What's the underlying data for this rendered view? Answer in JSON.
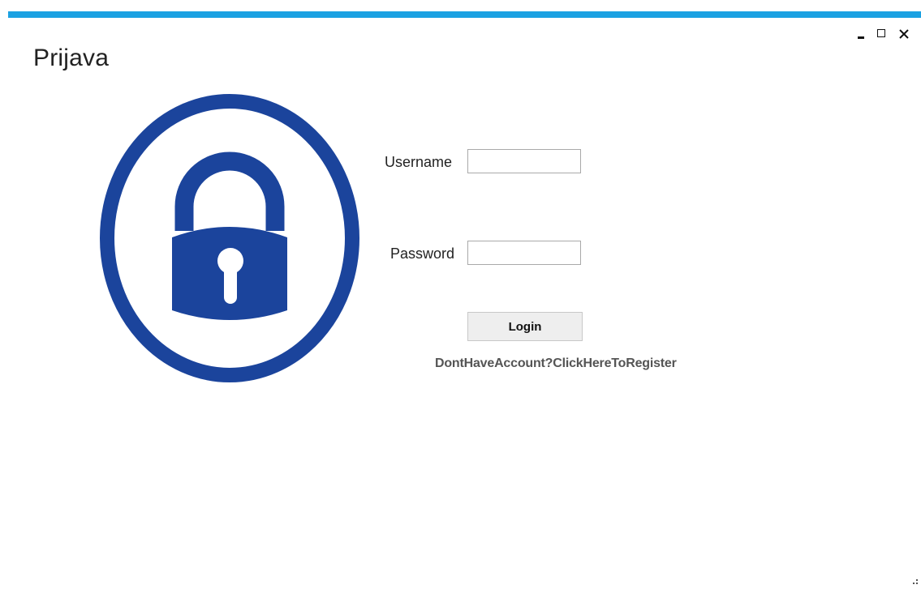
{
  "window": {
    "title": "Prijava",
    "accent_color": "#1ba1e2",
    "controls": [
      "minimize-icon",
      "maximize-icon",
      "close-icon"
    ]
  },
  "lock_graphic": {
    "icon": "padlock-icon",
    "color": "#1b449c"
  },
  "form": {
    "username_label": "Username",
    "username_value": "",
    "password_label": "Password",
    "password_value": "",
    "login_button": "Login",
    "register_link": "DontHaveAccount?ClickHereToRegister"
  }
}
